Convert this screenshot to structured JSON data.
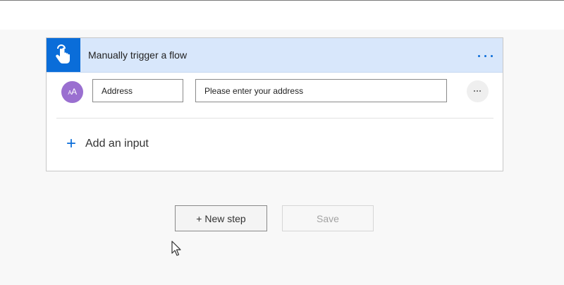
{
  "trigger_card": {
    "title": "Manually trigger a flow",
    "icon": "hand-pointer-icon",
    "accent_color": "#0a6dd9",
    "header_color": "#d8e7fb",
    "input": {
      "avatar_text": "AA",
      "avatar_color": "#9a6fd0",
      "name_value": "Address",
      "prompt_value": "Please enter your address"
    },
    "add_input_label": "Add an input"
  },
  "actions": {
    "new_step_label": "+ New step",
    "save_label": "Save"
  }
}
